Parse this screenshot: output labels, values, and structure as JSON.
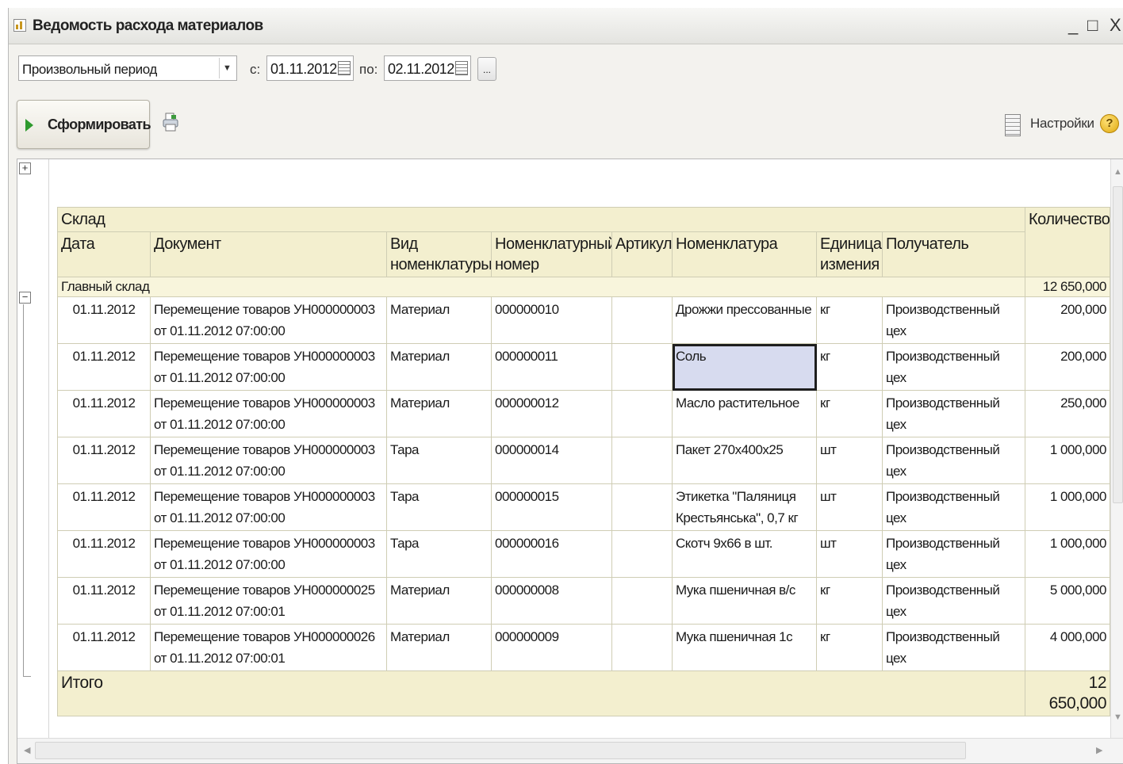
{
  "window": {
    "title": "Ведомость расхода материалов",
    "controls": {
      "minimize": "_",
      "maximize": "□",
      "close": "X"
    }
  },
  "period": {
    "type_value": "Произвольный период",
    "from_label": "с:",
    "from_value": "01.11.2012",
    "to_label": "по:",
    "to_value": "02.11.2012",
    "more_label": "..."
  },
  "toolbar": {
    "generate_label": "Сформировать",
    "settings_label": "Настройки",
    "help_label": "?"
  },
  "report": {
    "headers": {
      "warehouse": "Склад",
      "date": "Дата",
      "document": "Документ",
      "kind": "Вид номенклатуры",
      "code": "Номенклатурный номер",
      "article": "Артикул",
      "item": "Номенклатура",
      "unit": "Единица измения",
      "recipient": "Получатель",
      "quantity": "Количество"
    },
    "group": {
      "name": "Главный склад",
      "quantity": "12 650,000"
    },
    "rows": [
      {
        "date": "01.11.2012",
        "document": "Перемещение товаров УН000000003 от 01.11.2012 07:00:00",
        "kind": "Материал",
        "code": "000000010",
        "article": "",
        "item": "Дрожжи прессованные",
        "unit": "кг",
        "recipient": "Производственный цех",
        "quantity": "200,000"
      },
      {
        "date": "01.11.2012",
        "document": "Перемещение товаров УН000000003 от 01.11.2012 07:00:00",
        "kind": "Материал",
        "code": "000000011",
        "article": "",
        "item": "Соль",
        "unit": "кг",
        "recipient": "Производственный цех",
        "quantity": "200,000"
      },
      {
        "date": "01.11.2012",
        "document": "Перемещение товаров УН000000003 от 01.11.2012 07:00:00",
        "kind": "Материал",
        "code": "000000012",
        "article": "",
        "item": "Масло растительное",
        "unit": "кг",
        "recipient": "Производственный цех",
        "quantity": "250,000"
      },
      {
        "date": "01.11.2012",
        "document": "Перемещение товаров УН000000003 от 01.11.2012 07:00:00",
        "kind": "Тара",
        "code": "000000014",
        "article": "",
        "item": "Пакет 270х400х25",
        "unit": "шт",
        "recipient": "Производственный цех",
        "quantity": "1 000,000"
      },
      {
        "date": "01.11.2012",
        "document": "Перемещение товаров УН000000003 от 01.11.2012 07:00:00",
        "kind": "Тара",
        "code": "000000015",
        "article": "",
        "item": "Этикетка \"Паляниця Крестьянська\", 0,7 кг",
        "unit": "шт",
        "recipient": "Производственный цех",
        "quantity": "1 000,000"
      },
      {
        "date": "01.11.2012",
        "document": "Перемещение товаров УН000000003 от 01.11.2012 07:00:00",
        "kind": "Тара",
        "code": "000000016",
        "article": "",
        "item": "Скотч 9х66 в шт.",
        "unit": "шт",
        "recipient": "Производственный цех",
        "quantity": "1 000,000"
      },
      {
        "date": "01.11.2012",
        "document": "Перемещение товаров УН000000025 от 01.11.2012 07:00:01",
        "kind": "Материал",
        "code": "000000008",
        "article": "",
        "item": "Мука пшеничная в/с",
        "unit": "кг",
        "recipient": "Производственный цех",
        "quantity": "5 000,000"
      },
      {
        "date": "01.11.2012",
        "document": "Перемещение товаров УН000000026 от 01.11.2012 07:00:01",
        "kind": "Материал",
        "code": "000000009",
        "article": "",
        "item": "Мука пшеничная 1с",
        "unit": "кг",
        "recipient": "Производственный цех",
        "quantity": "4 000,000"
      }
    ],
    "total": {
      "label": "Итого",
      "quantity": "12 650,000"
    },
    "outline": {
      "expand": "+",
      "collapse": "−"
    }
  },
  "colors": {
    "header_bg": "#f3efcf",
    "group_bg": "#f8f5dc",
    "selected_cell": "#d7dbef",
    "play_icon": "#2e9a2e"
  }
}
